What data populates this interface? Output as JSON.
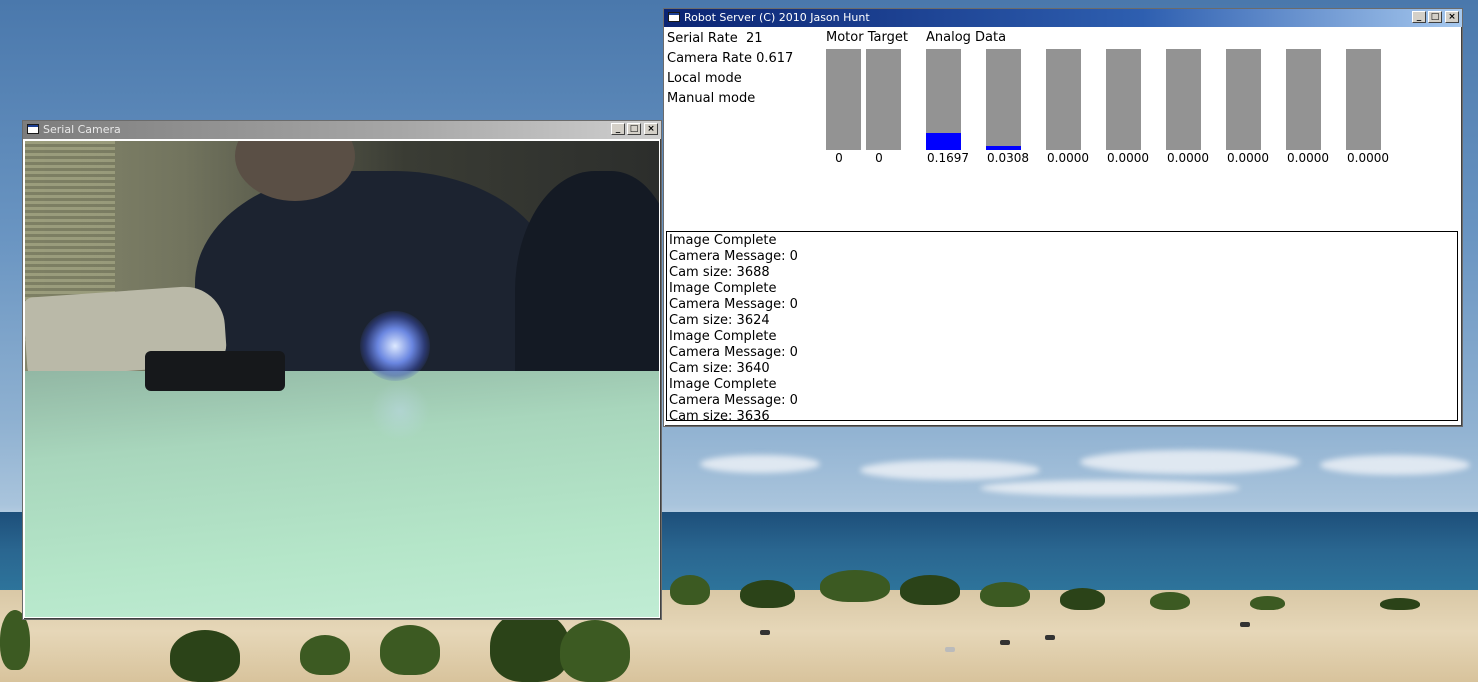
{
  "desktop": {
    "wallpaper": "beach-dunes-lake"
  },
  "camera_window": {
    "title": "Serial Camera",
    "controls": {
      "minimize": "_",
      "maximize": "□",
      "close": "×"
    }
  },
  "robot_window": {
    "title": "Robot Server (C) 2010 Jason Hunt",
    "controls": {
      "minimize": "_",
      "maximize": "□",
      "close": "×"
    },
    "status": {
      "serial_rate": "Serial Rate  21",
      "camera_rate": "Camera Rate 0.617",
      "local_mode": "Local mode",
      "manual_mode": "Manual mode"
    },
    "motor_header": "Motor Target",
    "analog_header": "Analog Data",
    "motor_bars": [
      {
        "label": "0",
        "level": 0
      },
      {
        "label": "0",
        "level": 0
      }
    ],
    "analog_bars": [
      {
        "label": "0.1697",
        "level": 0.17
      },
      {
        "label": "0.0308",
        "level": 0.04
      },
      {
        "label": "0.0000",
        "level": 0
      },
      {
        "label": "0.0000",
        "level": 0
      },
      {
        "label": "0.0000",
        "level": 0
      },
      {
        "label": "0.0000",
        "level": 0
      },
      {
        "label": "0.0000",
        "level": 0
      },
      {
        "label": "0.0000",
        "level": 0
      }
    ],
    "bar_color": "#939393",
    "fill_color": "#0000ff",
    "log": [
      "Image Complete",
      "Camera Message: 0",
      "Cam size: 3688",
      "Image Complete",
      "Camera Message: 0",
      "Cam size: 3624",
      "Image Complete",
      "Camera Message: 0",
      "Cam size: 3640",
      "Image Complete",
      "Camera Message: 0",
      "Cam size: 3636"
    ]
  }
}
